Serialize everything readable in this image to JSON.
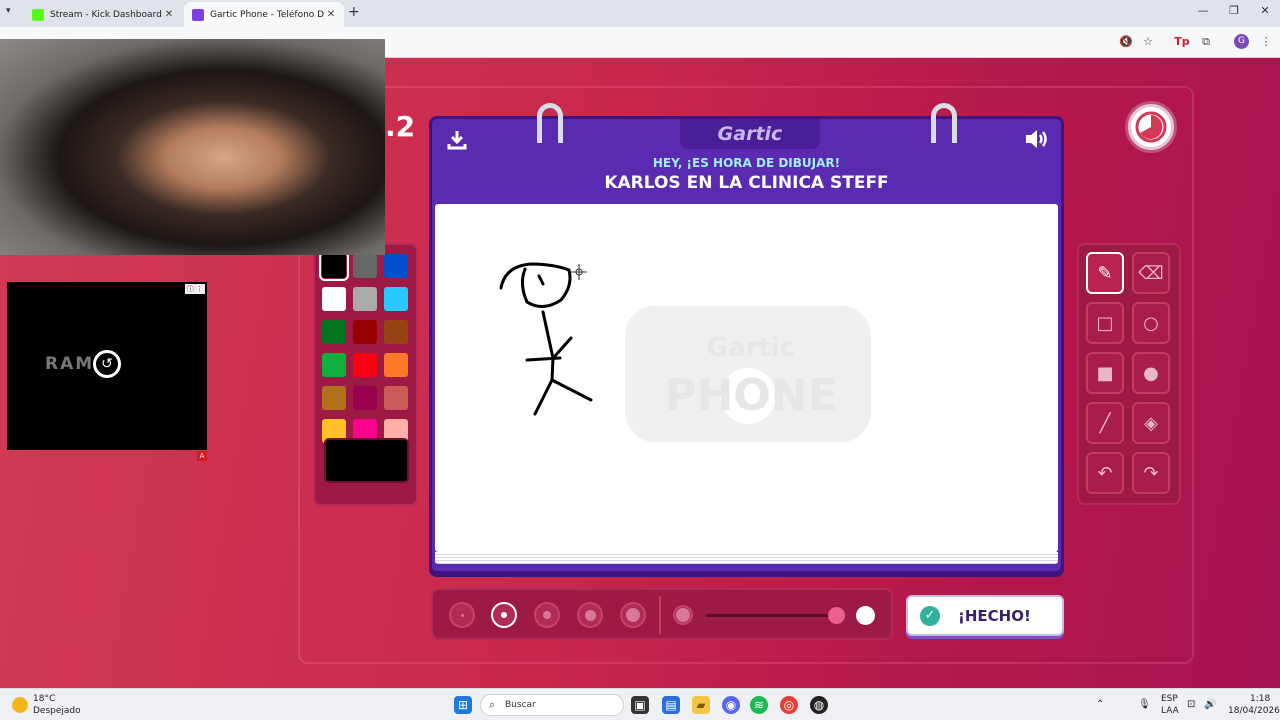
{
  "browser": {
    "tabs": [
      {
        "title": "Stream - Kick Dashboard",
        "favicon_color": "#53fc18"
      },
      {
        "title": "Gartic Phone - Teléfono Descon",
        "favicon_color": "#7b3fe4"
      }
    ],
    "new_tab_icon": "+",
    "window_controls": [
      "—",
      "❐",
      "✕"
    ]
  },
  "game": {
    "round": ".2",
    "logo": "Gartic",
    "prompt_small": "HEY, ¡ES HORA DE DIBUJAR!",
    "prompt_big": "KARLOS EN LA CLINICA STEFF",
    "watermark_top": "Gartic",
    "watermark_bottom": "PHONE",
    "done_label": "¡HECHO!",
    "palette": [
      "#000000",
      "#666666",
      "#0050cd",
      "#ffffff",
      "#aaaaaa",
      "#26c9ff",
      "#017420",
      "#990000",
      "#964112",
      "#11b03c",
      "#ff0013",
      "#ff7829",
      "#b0701c",
      "#99004e",
      "#cb5a57",
      "#ffc126",
      "#ff008f",
      "#feafa8"
    ],
    "selected_color": "#000000",
    "tools": [
      "pen",
      "eraser",
      "rect-outline",
      "circle-outline",
      "rect-fill",
      "circle-fill",
      "line",
      "fill-bucket",
      "undo",
      "redo"
    ],
    "selected_tool": "pen",
    "brush_sizes": 5,
    "selected_brush": 2
  },
  "ad": {
    "brand": "RAM",
    "info": "ⓘ ⋮",
    "badge": "A"
  },
  "taskbar": {
    "weather_temp": "18°C",
    "weather_desc": "Despejado",
    "search_placeholder": "Buscar",
    "lang_top": "ESP",
    "lang_bottom": "LAA",
    "time": "1:18",
    "date": "18/04/2026"
  }
}
